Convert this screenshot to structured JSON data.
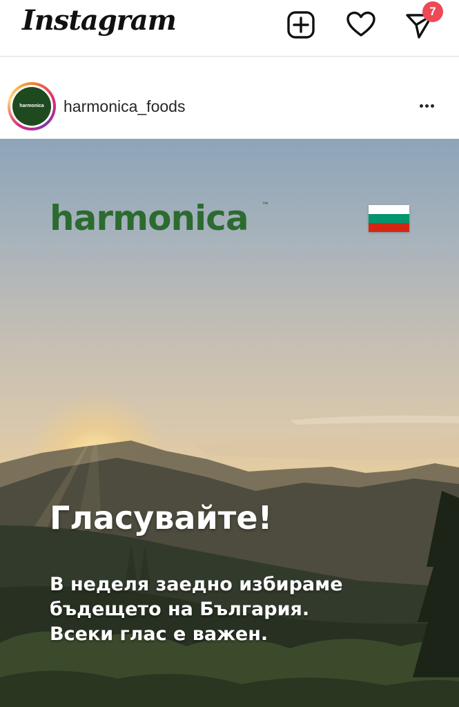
{
  "app": {
    "logo_text": "Instagram",
    "notification_count": "7"
  },
  "icons": {
    "new_post": "plus-square-icon",
    "activity": "heart-icon",
    "direct": "paper-plane-icon",
    "more": "ellipsis-icon"
  },
  "post": {
    "username": "harmonica_foods",
    "avatar_text": "harmonica",
    "image": {
      "brand": "harmonica",
      "trademark": "™",
      "headline": "Гласувайте!",
      "lines": [
        "В неделя заедно избираме",
        "бъдещето на България.",
        "Всеки глас е важен."
      ]
    }
  },
  "colors": {
    "badge": "#ed4956",
    "brand_green": "#2c6b2f",
    "flag_white": "#ffffff",
    "flag_green": "#00966e",
    "flag_red": "#d62612"
  }
}
